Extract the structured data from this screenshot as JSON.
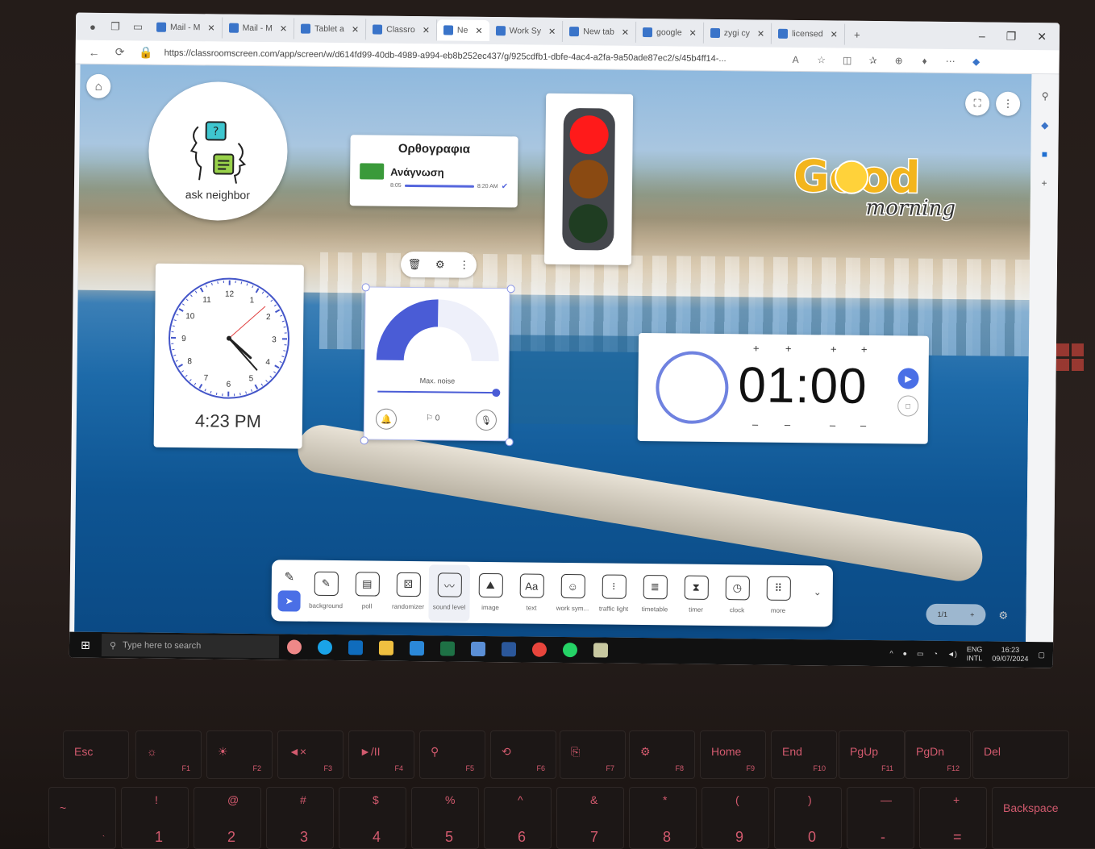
{
  "browser": {
    "tabs": [
      {
        "label": "Mail - M",
        "active": false
      },
      {
        "label": "Mail - M",
        "active": false
      },
      {
        "label": "Tablet a",
        "active": false
      },
      {
        "label": "Classro",
        "active": false
      },
      {
        "label": "Ne",
        "active": true
      },
      {
        "label": "Work Sy",
        "active": false
      },
      {
        "label": "New tab",
        "active": false
      },
      {
        "label": "google",
        "active": false
      },
      {
        "label": "zygi cy",
        "active": false
      },
      {
        "label": "licensed",
        "active": false
      }
    ],
    "url": "https://classroomscreen.com/app/screen/w/d614fd99-40db-4989-a994-eb8b252ec437/g/925cdfb1-dbfe-4ac4-a2fa-9a50ade87ec2/s/45b4ff14-..."
  },
  "widgets": {
    "ask_neighbor": {
      "label": "ask neighbor"
    },
    "timetable": {
      "title": "Ορθογραφια",
      "item": "Ανάγνωση",
      "start": "8:05",
      "end": "8:20 AM"
    },
    "traffic_light": {
      "state": "red",
      "red": "#ff1a1a",
      "yellow": "#8a4a12",
      "green": "#1f3d22"
    },
    "greeting": {
      "word1": "Good",
      "word2": "morning"
    },
    "clock": {
      "time": "4:23 PM",
      "numbers": [
        "12",
        "1",
        "2",
        "3",
        "4",
        "5",
        "6",
        "7",
        "8",
        "9",
        "10",
        "11"
      ],
      "hour": 4,
      "minute": 23,
      "second": 8
    },
    "sound_level": {
      "label": "Max. noise",
      "count": "0",
      "level": 0.55
    },
    "timer": {
      "time": "01:00"
    }
  },
  "toolbar": {
    "tools": [
      {
        "label": "background",
        "icon": "pencil-icon"
      },
      {
        "label": "poll",
        "icon": "poll-icon"
      },
      {
        "label": "randomizer",
        "icon": "randomizer-icon"
      },
      {
        "label": "sound level",
        "icon": "sound-level-icon"
      },
      {
        "label": "image",
        "icon": "image-icon"
      },
      {
        "label": "text",
        "icon": "text-icon"
      },
      {
        "label": "work sym...",
        "icon": "work-symbols-icon"
      },
      {
        "label": "traffic light",
        "icon": "traffic-light-icon"
      },
      {
        "label": "timetable",
        "icon": "timetable-icon"
      },
      {
        "label": "timer",
        "icon": "hourglass-icon"
      },
      {
        "label": "clock",
        "icon": "clock-icon"
      },
      {
        "label": "more",
        "icon": "more-grid-icon"
      }
    ],
    "selected": "sound level"
  },
  "page_indicator": "1/1",
  "taskbar": {
    "search_placeholder": "Type here to search",
    "lang1": "ENG",
    "lang2": "INTL",
    "time": "16:23",
    "date": "09/07/2024"
  },
  "keyboard": {
    "frow": [
      {
        "k": "Esc",
        "s": ""
      },
      {
        "k": "☼",
        "s": "F1"
      },
      {
        "k": "☀",
        "s": "F2"
      },
      {
        "k": "◄×",
        "s": "F3"
      },
      {
        "k": "►/II",
        "s": "F4"
      },
      {
        "k": "⚲",
        "s": "F5"
      },
      {
        "k": "⟲",
        "s": "F6"
      },
      {
        "k": "⎘",
        "s": "F7"
      },
      {
        "k": "⚙",
        "s": "F8"
      },
      {
        "k": "Home",
        "s": "F9"
      },
      {
        "k": "End",
        "s": "F10"
      },
      {
        "k": "PgUp",
        "s": "F11"
      },
      {
        "k": "PgDn",
        "s": "F12"
      },
      {
        "k": "Del",
        "s": ""
      }
    ],
    "numrow": [
      {
        "k": "~",
        "s": "`"
      },
      {
        "k": "!",
        "s": "1"
      },
      {
        "k": "@",
        "s": "2"
      },
      {
        "k": "#",
        "s": "3"
      },
      {
        "k": "$",
        "s": "4"
      },
      {
        "k": "%",
        "s": "5"
      },
      {
        "k": "^",
        "s": "6"
      },
      {
        "k": "&",
        "s": "7"
      },
      {
        "k": "*",
        "s": "8"
      },
      {
        "k": "(",
        "s": "9"
      },
      {
        "k": ")",
        "s": "0"
      },
      {
        "k": "—",
        "s": "-"
      },
      {
        "k": "+",
        "s": "="
      },
      {
        "k": "Backspace",
        "s": ""
      }
    ]
  }
}
